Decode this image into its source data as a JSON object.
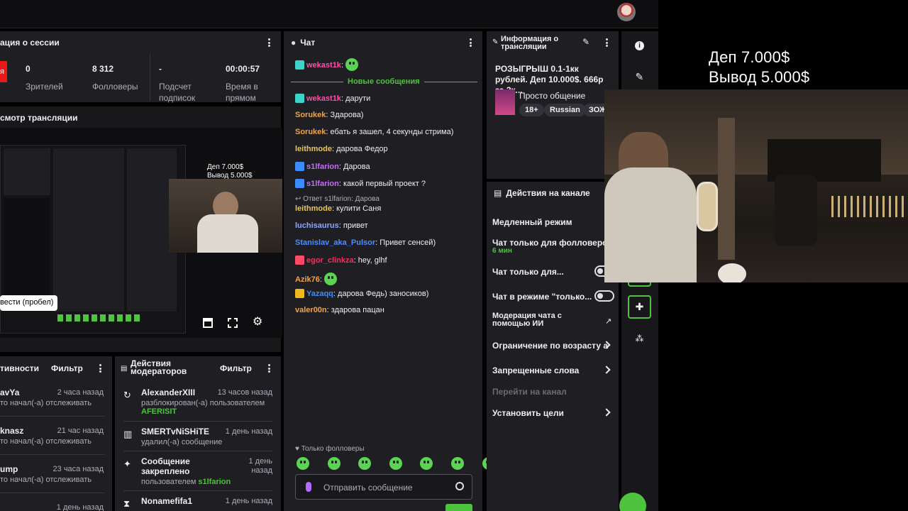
{
  "session": {
    "title": "ация о сессии",
    "live_badge": "я",
    "stats": [
      {
        "value": "0",
        "label": "Зрителей"
      },
      {
        "value": "8 312",
        "label": "Фолловеры"
      },
      {
        "value": "-",
        "label": "Подсчет подписок"
      },
      {
        "value": "00:00:57",
        "label": "Время в прямом"
      }
    ]
  },
  "preview": {
    "title": "смотр трансляции",
    "tooltip": "вести (пробел)",
    "mini_deposit": "Деп 7.000$",
    "mini_withdraw": "Вывод  5.000$"
  },
  "chat": {
    "title": "Чат",
    "new_messages": "Новые сообщения",
    "messages": [
      {
        "user": "wekast1k",
        "text": "",
        "color": "#ff4fa6",
        "emote": true
      },
      {
        "user": "wekast1k",
        "text": "дарути",
        "color": "#ff4fa6"
      },
      {
        "user": "Sorukek",
        "text": "Здарова)",
        "color": "#f0a44a"
      },
      {
        "user": "Sorukek",
        "text": "ебать я зашел, 4 секунды стрима)",
        "color": "#f0a44a"
      },
      {
        "user": "leithmode",
        "text": "дарова Федор",
        "color": "#e6c65a"
      },
      {
        "user": "s1lfarion",
        "text": "Дарова",
        "color": "#c16cf5"
      },
      {
        "user": "s1lfarion",
        "text": "какой первый проект ?",
        "color": "#c16cf5"
      },
      {
        "user": "leithmode",
        "text": "кулити Саня",
        "color": "#e6c65a"
      },
      {
        "user": "luchisaurus",
        "text": "привет",
        "color": "#8fa6ff"
      },
      {
        "user": "Stanislav_aka_Pulsor",
        "text": "Привет сенсей)",
        "color": "#4d8bff"
      },
      {
        "user": "egor_clinkza",
        "text": "hey, glhf",
        "color": "#ff2a5a"
      },
      {
        "user": "Azik76",
        "text": "",
        "color": "#f0a44a",
        "emote": true
      },
      {
        "user": "Yazaqq",
        "text": "дарова Федь) заносиков)",
        "color": "#3d8cff"
      },
      {
        "user": "valer00n",
        "text": "здарова пацан",
        "color": "#f0a44a"
      }
    ],
    "reply_note": "Ответ s1lfarion: Дарова",
    "followers_only": "Только фолловеры",
    "input_placeholder": "Отправить сообщение"
  },
  "stream_info": {
    "title": "Информация о трансляции",
    "stream_title": "РОЗЫГРЫШ 0.1-1кк рублей. Деп 10.000$. 666р за 2к...",
    "category": "Просто общение",
    "tags": [
      "18+",
      "Russian",
      "ЗОЖ"
    ]
  },
  "channel_actions": {
    "title": "Действия на канале",
    "items": [
      {
        "label": "Медленный режим"
      },
      {
        "label": "Чат только для фолловеров",
        "sub": "6 мин"
      },
      {
        "label": "Чат только для..."
      },
      {
        "label": "Чат в режиме \"только..."
      },
      {
        "label": "Модерация чата с помощью ИИ"
      },
      {
        "label": "Ограничение по возрасту а"
      },
      {
        "label": "Запрещенные слова"
      },
      {
        "label": "Перейти на канал"
      },
      {
        "label": "Установить цели"
      }
    ]
  },
  "activity": {
    "title": "тивности",
    "filter": "Фильтр",
    "items": [
      {
        "name": "avYa",
        "time": "2 часа назад",
        "desc": "то начал(-а) отслеживать"
      },
      {
        "name": "knasz",
        "time": "21 час назад",
        "desc": "то начал(-а) отслеживать"
      },
      {
        "name": "ump",
        "time": "23 часа назад",
        "desc": "то начал(-а) отслеживать"
      },
      {
        "name": "",
        "time": "1 день назад",
        "desc": ""
      }
    ]
  },
  "mod_actions": {
    "title": "Действия модераторов",
    "filter": "Фильтр",
    "items": [
      {
        "name": "AlexanderXIII",
        "time": "13 часов назад",
        "desc": "разблокирован(-а) пользователем",
        "highlight": "AFERISIT"
      },
      {
        "name": "SMERTvNiSHiTE",
        "time": "1 день назад",
        "desc": "удалил(-а) сообщение",
        "highlight": ""
      },
      {
        "name": "Сообщение закреплено",
        "time": "1 день назад",
        "desc": "пользователем",
        "highlight": "s1lfarion"
      },
      {
        "name": "Nonamefifa1",
        "time": "1 день назад",
        "desc": "",
        "highlight": ""
      }
    ]
  },
  "overlay": {
    "deposit": "Деп 7.000$",
    "withdraw": "Вывод  5.000$"
  },
  "colors": {
    "accent": "#4ec33d",
    "panel": "#1f1f23",
    "background": "#0e0e10"
  }
}
